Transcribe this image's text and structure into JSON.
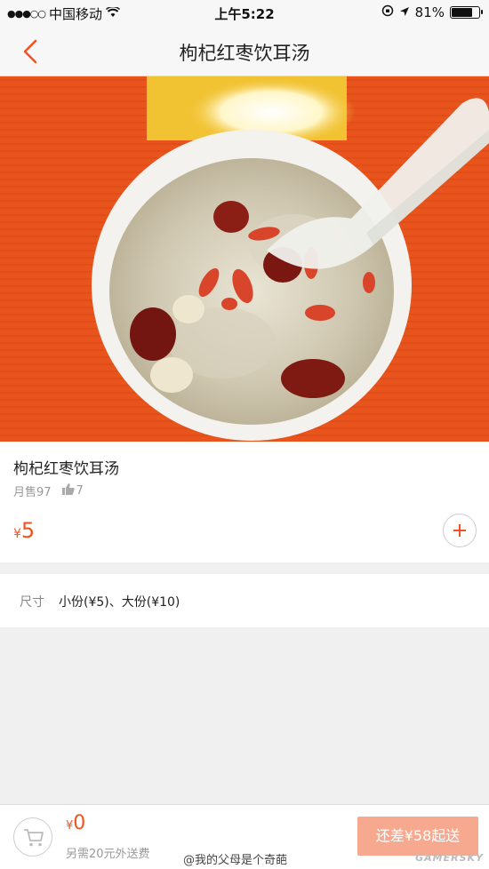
{
  "status_bar": {
    "carrier": "中国移动",
    "time": "上午5:22",
    "battery": "81%",
    "battery_level": 0.81
  },
  "nav": {
    "title": "枸杞红枣饮耳汤"
  },
  "dish": {
    "name": "枸杞红枣饮耳汤",
    "monthly_sales": "月售97",
    "likes": "7",
    "currency": "¥",
    "price": "5"
  },
  "spec": {
    "label": "尺寸",
    "value": "小份(¥5)、大份(¥10)"
  },
  "cart": {
    "currency": "¥",
    "total": "0",
    "delivery_note": "另需20元外送费",
    "checkout_label": "还差¥58起送"
  },
  "watermarks": {
    "user": "@我的父母是个奇葩",
    "site": "GAMERSKY"
  },
  "colors": {
    "accent": "#f4511e",
    "checkout_disabled": "#f7a990",
    "background": "#f0f0f0"
  },
  "icons": {
    "back": "chevron-left-icon",
    "add": "plus-icon",
    "cart": "cart-icon",
    "thumb": "thumb-up-icon"
  }
}
